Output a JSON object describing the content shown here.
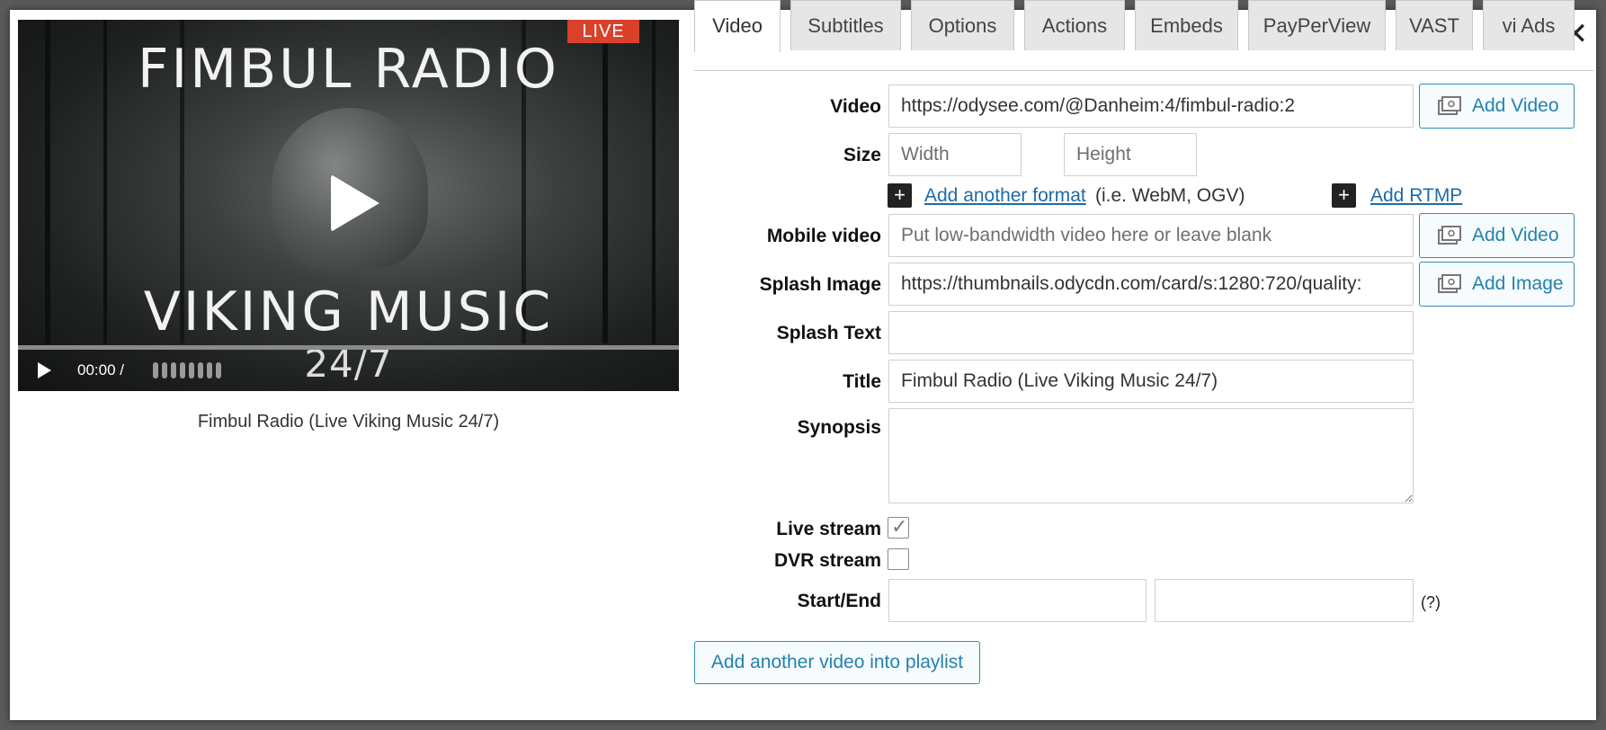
{
  "preview": {
    "title_line1": "FIMBUL RADIO",
    "title_line2": "VIKING MUSIC",
    "title_line3": "24/7",
    "live_badge": "LIVE",
    "time": "00:00 /",
    "caption": "Fimbul Radio (Live Viking Music 24/7)"
  },
  "close_label": "✕",
  "tabs": [
    {
      "label": "Video",
      "active": true
    },
    {
      "label": "Subtitles"
    },
    {
      "label": "Options"
    },
    {
      "label": "Actions"
    },
    {
      "label": "Embeds"
    },
    {
      "label": "PayPerView"
    },
    {
      "label": "VAST"
    },
    {
      "label": "vi Ads"
    }
  ],
  "form": {
    "video": {
      "label": "Video",
      "value": "https://odysee.com/@Danheim:4/fimbul-radio:2",
      "button": "Add Video"
    },
    "size": {
      "label": "Size",
      "width_placeholder": "Width",
      "height_placeholder": "Height"
    },
    "another_format": {
      "link": "Add another format",
      "hint": "(i.e. WebM, OGV)"
    },
    "rtmp": {
      "link": "Add RTMP"
    },
    "mobile_video": {
      "label": "Mobile video",
      "placeholder": "Put low-bandwidth video here or leave blank",
      "button": "Add Video"
    },
    "splash_image": {
      "label": "Splash Image",
      "value": "https://thumbnails.odycdn.com/card/s:1280:720/quality:",
      "button": "Add Image"
    },
    "splash_text": {
      "label": "Splash Text",
      "value": ""
    },
    "title": {
      "label": "Title",
      "value": "Fimbul Radio (Live Viking Music 24/7)"
    },
    "synopsis": {
      "label": "Synopsis",
      "value": ""
    },
    "live_stream": {
      "label": "Live stream",
      "checked": true
    },
    "dvr_stream": {
      "label": "DVR stream",
      "checked": false
    },
    "start_end": {
      "label": "Start/End",
      "help": "(?)"
    }
  },
  "playlist_button": "Add another video into playlist",
  "colors": {
    "accent": "#2382ad",
    "live": "#d9412b",
    "tab_bg": "#e6e6e6"
  }
}
